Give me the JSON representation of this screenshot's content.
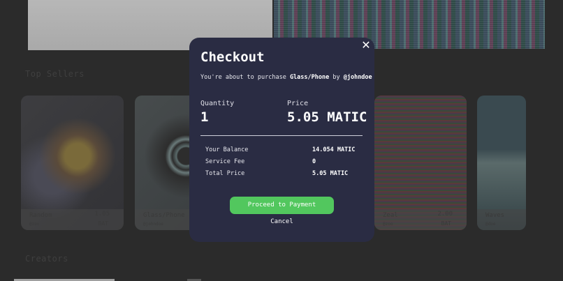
{
  "background": {
    "sections": {
      "top_sellers": "Top Sellers",
      "creators": "Creators"
    },
    "cards": [
      {
        "name": "Random",
        "user": "@zoo",
        "price": "1.05",
        "currency": "BAT"
      },
      {
        "name": "Glass/Phone",
        "user": "@johndoe",
        "price": "",
        "currency": ""
      },
      {
        "name": "Zeal",
        "user": "@zoo",
        "price": "2.00",
        "currency": "BAT"
      },
      {
        "name": "Waves",
        "user": "@doe",
        "price": "",
        "currency": ""
      }
    ]
  },
  "modal": {
    "title": "Checkout",
    "close_icon": "close-icon",
    "subtitle": {
      "prefix": "You're about to purchase ",
      "item": "Glass/Phone",
      "by": " by ",
      "creator": "@johndoe"
    },
    "quantity": {
      "label": "Quantity",
      "value": "1"
    },
    "price": {
      "label": "Price",
      "value": "5.05 MATIC"
    },
    "summary": [
      {
        "label": "Your Balance",
        "value": "14.054 MATIC"
      },
      {
        "label": "Service Fee",
        "value": "0"
      },
      {
        "label": "Total Price",
        "value": "5.05 MATIC"
      }
    ],
    "proceed_label": "Proceed to Payment",
    "cancel_label": "Cancel"
  },
  "colors": {
    "modal_bg": "#2a2c43",
    "accent_green": "#52c75e",
    "page_bg": "#2b2b2b"
  }
}
